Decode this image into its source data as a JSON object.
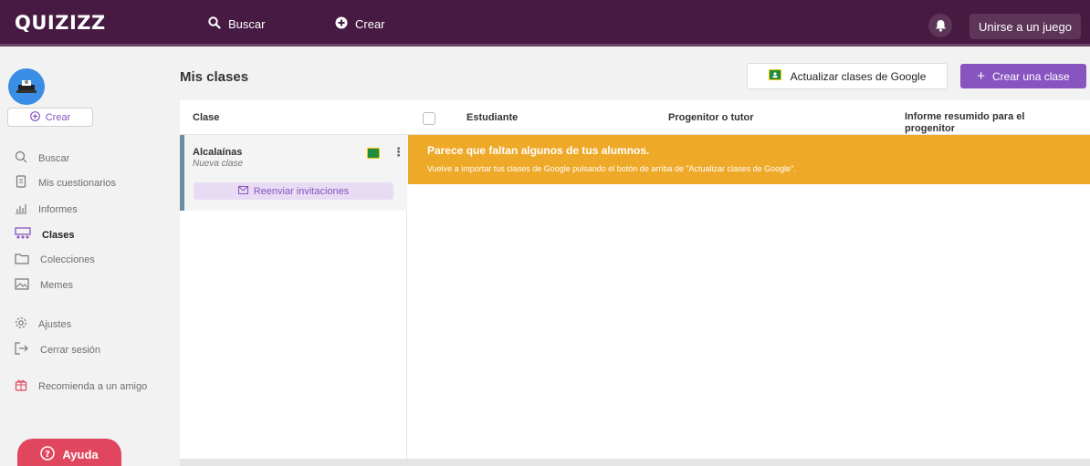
{
  "header": {
    "logo": "QUIZIZZ",
    "search_label": "Buscar",
    "create_label": "Crear",
    "join_label": "Unirse a un juego"
  },
  "sidebar": {
    "create_label": "Crear",
    "items": [
      {
        "label": "Buscar",
        "icon": "search-icon"
      },
      {
        "label": "Mis cuestionarios",
        "icon": "document-icon"
      },
      {
        "label": "Informes",
        "icon": "chart-icon"
      },
      {
        "label": "Clases",
        "icon": "classes-icon",
        "active": true
      },
      {
        "label": "Colecciones",
        "icon": "folder-icon"
      },
      {
        "label": "Memes",
        "icon": "image-icon"
      },
      {
        "label": "Ajustes",
        "icon": "gear-icon"
      },
      {
        "label": "Cerrar sesión",
        "icon": "logout-icon"
      },
      {
        "label": "Recomienda a un amigo",
        "icon": "gift-icon"
      }
    ],
    "help_label": "Ayuda"
  },
  "main": {
    "title": "Mis clases",
    "google_button": "Actualizar clases de Google",
    "create_class_button": "Crear una clase",
    "columns": [
      "Clase",
      "Estudiante",
      "Progenitor o tutor",
      "Informe resumido para el progenitor"
    ],
    "class": {
      "name": "Alcalaínas",
      "subtitle": "Nueva clase",
      "resend_label": "Reenviar invitaciones"
    },
    "alert": {
      "title": "Parece que faltan algunos de tus alumnos.",
      "body": "Vuelve a importar tus clases de Google pulsando el botón de arriba de \"Actualizar clases de Google\"."
    }
  },
  "colors": {
    "topbar": "#461a42",
    "accent": "#8854c0",
    "alert": "#efa929",
    "help": "#e0475e"
  }
}
